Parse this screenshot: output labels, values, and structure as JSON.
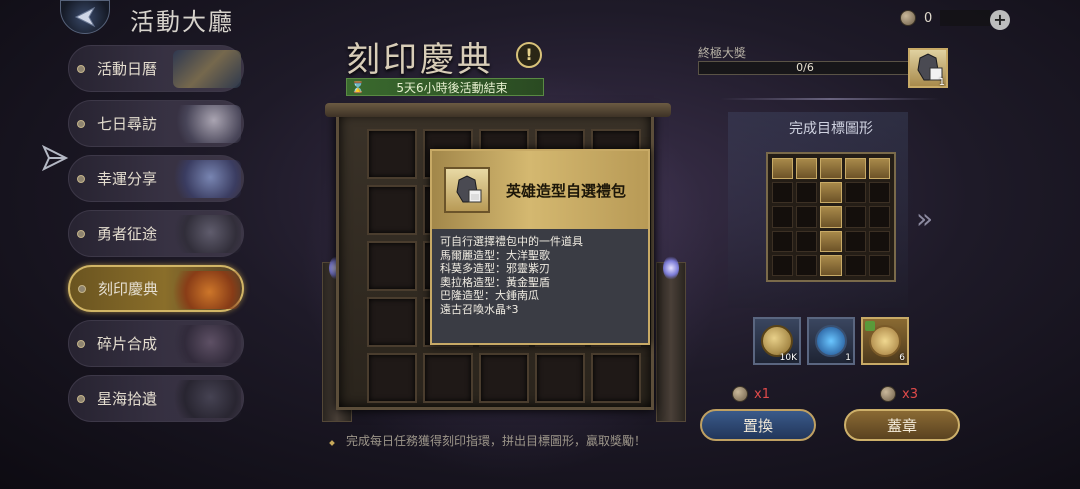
{
  "header": {
    "title": "活動大廳",
    "currency_value": "0",
    "plus_label": "+"
  },
  "sidebar": {
    "items": [
      {
        "label": "活動日曆"
      },
      {
        "label": "七日尋訪"
      },
      {
        "label": "幸運分享"
      },
      {
        "label": "勇者征途"
      },
      {
        "label": "刻印慶典"
      },
      {
        "label": "碎片合成"
      },
      {
        "label": "星海拾遺"
      }
    ],
    "active_index": 4
  },
  "event": {
    "title": "刻印慶典",
    "info_label": "!",
    "timer_icon": "⌛",
    "timer_text": "5天6小時後活動結束",
    "hint": "完成每日任務獲得刻印指環，拼出目標圖形，贏取獎勵！"
  },
  "popup": {
    "title": "英雄造型自選禮包",
    "lines": [
      "可自行選擇禮包中的一件道具",
      "馬爾麗造型：大洋聖歌",
      "科莫多造型：邪靈紫刃",
      "奧拉格造型：黃金聖盾",
      "巴隆造型：大錘南瓜",
      "遠古召喚水晶*3"
    ]
  },
  "final_reward": {
    "label": "終極大獎",
    "progress_text": "0/6",
    "progress_fraction": 0.0,
    "reward_count": "1"
  },
  "target": {
    "title": "完成目標圖形",
    "pattern": [
      [
        1,
        1,
        1,
        1,
        1
      ],
      [
        0,
        0,
        1,
        0,
        0
      ],
      [
        0,
        0,
        1,
        0,
        0
      ],
      [
        0,
        0,
        1,
        0,
        0
      ],
      [
        0,
        0,
        1,
        0,
        0
      ]
    ],
    "next_icon": "»"
  },
  "items": [
    {
      "icon": "coin-icon",
      "count": "10K"
    },
    {
      "icon": "gem-icon",
      "count": "1"
    },
    {
      "icon": "scroll-icon",
      "count": "6"
    }
  ],
  "actions": {
    "swap_cost": "x1",
    "stamp_cost": "x3",
    "swap_label": "置換",
    "stamp_label": "蓋章"
  },
  "colors": {
    "accent_gold": "#c8aa66",
    "timer_green": "#3a6a2e",
    "cost_red": "#e04a4a"
  }
}
